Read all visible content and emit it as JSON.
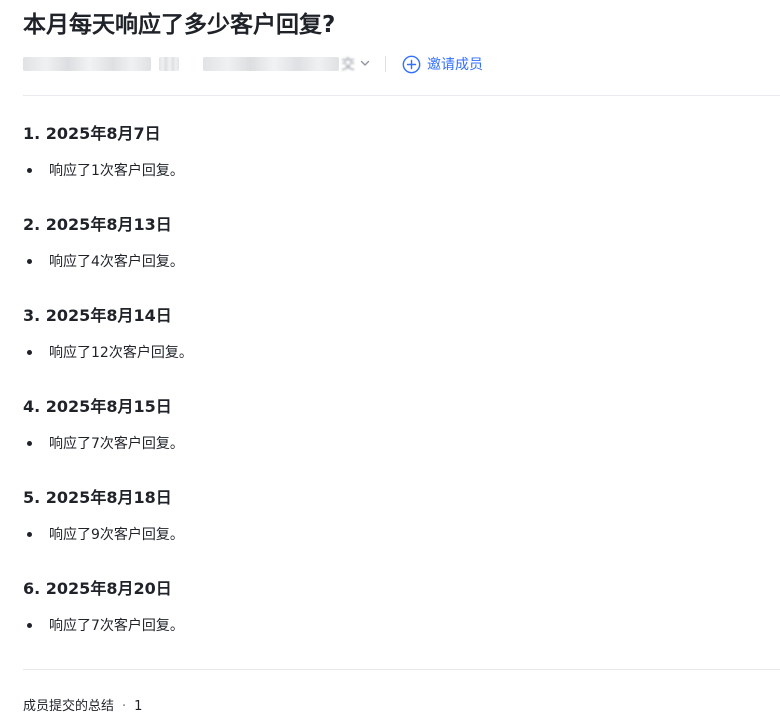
{
  "page": {
    "title": "本月每天响应了多少客户回复?"
  },
  "meta": {
    "blurred_tail": "交",
    "invite_label": "邀请成员"
  },
  "entries": [
    {
      "heading": "1. 2025年8月7日",
      "bullet": "响应了1次客户回复。"
    },
    {
      "heading": "2. 2025年8月13日",
      "bullet": "响应了4次客户回复。"
    },
    {
      "heading": "3. 2025年8月14日",
      "bullet": "响应了12次客户回复。"
    },
    {
      "heading": "4. 2025年8月15日",
      "bullet": "响应了7次客户回复。"
    },
    {
      "heading": "5. 2025年8月18日",
      "bullet": "响应了9次客户回复。"
    },
    {
      "heading": "6. 2025年8月20日",
      "bullet": "响应了7次客户回复。"
    }
  ],
  "footer": {
    "label": "成员提交的总结",
    "separator": "·",
    "count": "1"
  },
  "colors": {
    "accent": "#3370ff",
    "text": "#1f2329",
    "divider": "#e8eaed"
  },
  "icons": {
    "invite": "plus-circle-icon",
    "dropdown": "chevron-down-icon"
  }
}
